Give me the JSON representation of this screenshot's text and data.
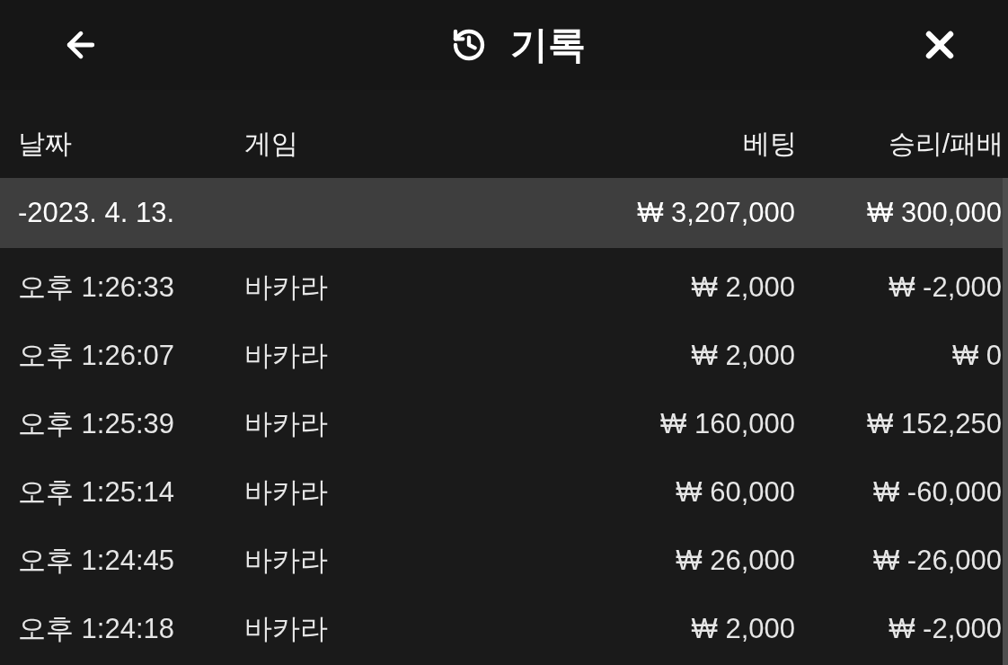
{
  "header": {
    "title": "기록"
  },
  "table": {
    "columns": [
      "날짜",
      "게임",
      "베팅",
      "승리/패배"
    ],
    "groups": [
      {
        "date": "-2023. 4. 13.",
        "total_bet": "₩ 3,207,000",
        "total_result": "₩ 300,000",
        "rows": [
          {
            "time": "오후 1:26:33",
            "game": "바카라",
            "bet": "₩ 2,000",
            "result": "₩ -2,000"
          },
          {
            "time": "오후 1:26:07",
            "game": "바카라",
            "bet": "₩ 2,000",
            "result": "₩ 0"
          },
          {
            "time": "오후 1:25:39",
            "game": "바카라",
            "bet": "₩ 160,000",
            "result": "₩ 152,250"
          },
          {
            "time": "오후 1:25:14",
            "game": "바카라",
            "bet": "₩ 60,000",
            "result": "₩ -60,000"
          },
          {
            "time": "오후 1:24:45",
            "game": "바카라",
            "bet": "₩ 26,000",
            "result": "₩ -26,000"
          },
          {
            "time": "오후 1:24:18",
            "game": "바카라",
            "bet": "₩ 2,000",
            "result": "₩ -2,000"
          }
        ]
      }
    ]
  }
}
